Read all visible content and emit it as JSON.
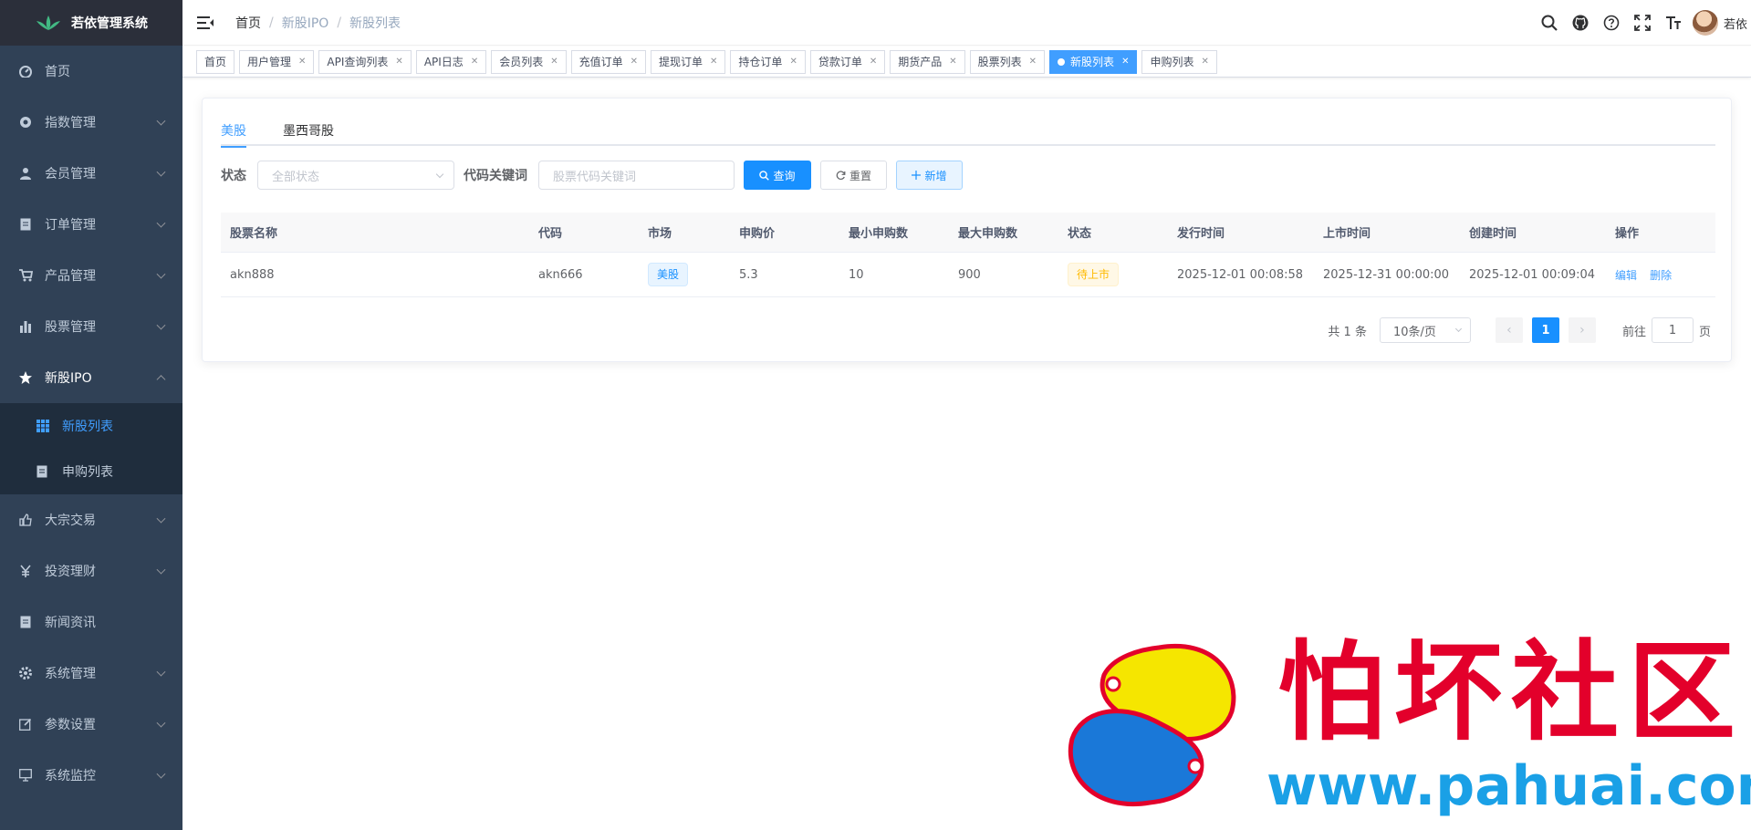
{
  "app": {
    "title": "若依管理系统"
  },
  "sidebar": {
    "items": [
      {
        "label": "首页",
        "icon": "dashboard-icon",
        "arrow": false
      },
      {
        "label": "指数管理",
        "icon": "gear-circle-icon",
        "arrow": true
      },
      {
        "label": "会员管理",
        "icon": "user-icon",
        "arrow": true
      },
      {
        "label": "订单管理",
        "icon": "document-icon",
        "arrow": true
      },
      {
        "label": "产品管理",
        "icon": "cart-icon",
        "arrow": true
      },
      {
        "label": "股票管理",
        "icon": "bar-chart-icon",
        "arrow": true
      },
      {
        "label": "新股IPO",
        "icon": "star-icon",
        "arrow": true,
        "open": true
      },
      {
        "label": "大宗交易",
        "icon": "thumb-icon",
        "arrow": true
      },
      {
        "label": "投资理财",
        "icon": "yen-icon",
        "arrow": true
      },
      {
        "label": "新闻资讯",
        "icon": "news-icon",
        "arrow": false
      },
      {
        "label": "系统管理",
        "icon": "system-gear-icon",
        "arrow": true
      },
      {
        "label": "参数设置",
        "icon": "edit-icon",
        "arrow": true
      },
      {
        "label": "系统监控",
        "icon": "monitor-icon",
        "arrow": true
      }
    ],
    "sub_items": [
      {
        "label": "新股列表",
        "icon": "table-icon",
        "active": true
      },
      {
        "label": "申购列表",
        "icon": "document-icon",
        "active": false
      }
    ]
  },
  "navbar": {
    "breadcrumb": [
      "首页",
      "新股IPO",
      "新股列表"
    ],
    "username": "若依"
  },
  "tags": [
    {
      "label": "首页",
      "closable": false
    },
    {
      "label": "用户管理",
      "closable": true
    },
    {
      "label": "API查询列表",
      "closable": true
    },
    {
      "label": "API日志",
      "closable": true
    },
    {
      "label": "会员列表",
      "closable": true
    },
    {
      "label": "充值订单",
      "closable": true
    },
    {
      "label": "提现订单",
      "closable": true
    },
    {
      "label": "持仓订单",
      "closable": true
    },
    {
      "label": "贷款订单",
      "closable": true
    },
    {
      "label": "期货产品",
      "closable": true
    },
    {
      "label": "股票列表",
      "closable": true
    },
    {
      "label": "新股列表",
      "closable": true,
      "active": true
    },
    {
      "label": "申购列表",
      "closable": true
    }
  ],
  "tabs": [
    {
      "label": "美股",
      "active": true
    },
    {
      "label": "墨西哥股",
      "active": false
    }
  ],
  "filters": {
    "status_label": "状态",
    "status_placeholder": "全部状态",
    "keyword_label": "代码关键词",
    "keyword_placeholder": "股票代码关键词",
    "search_label": "查询",
    "reset_label": "重置",
    "add_label": "新增"
  },
  "table": {
    "headers": [
      "股票名称",
      "代码",
      "市场",
      "申购价",
      "最小申购数",
      "最大申购数",
      "状态",
      "发行时间",
      "上市时间",
      "创建时间",
      "操作"
    ],
    "rows": [
      {
        "name": "akn888",
        "code": "akn666",
        "market": "美股",
        "price": "5.3",
        "min": "10",
        "max": "900",
        "status": "待上市",
        "issue_time": "2025-12-01 00:08:58",
        "list_time": "2025-12-31 00:00:00",
        "created": "2025-12-01 00:09:04",
        "edit": "编辑",
        "delete": "删除"
      }
    ]
  },
  "pagination": {
    "total": "共 1 条",
    "page_size": "10条/页",
    "current": "1",
    "goto_prefix": "前往",
    "goto_value": "1",
    "goto_suffix": "页"
  },
  "watermark": {
    "text": "怕坏社区",
    "url": "www.pahuai.com"
  },
  "colors": {
    "sidebar": "#304156",
    "primary": "#1890ff",
    "active_menu": "#409eff",
    "warning": "#ffba00",
    "watermark_red": "#e3002b",
    "watermark_blue": "#1aa0e6"
  }
}
